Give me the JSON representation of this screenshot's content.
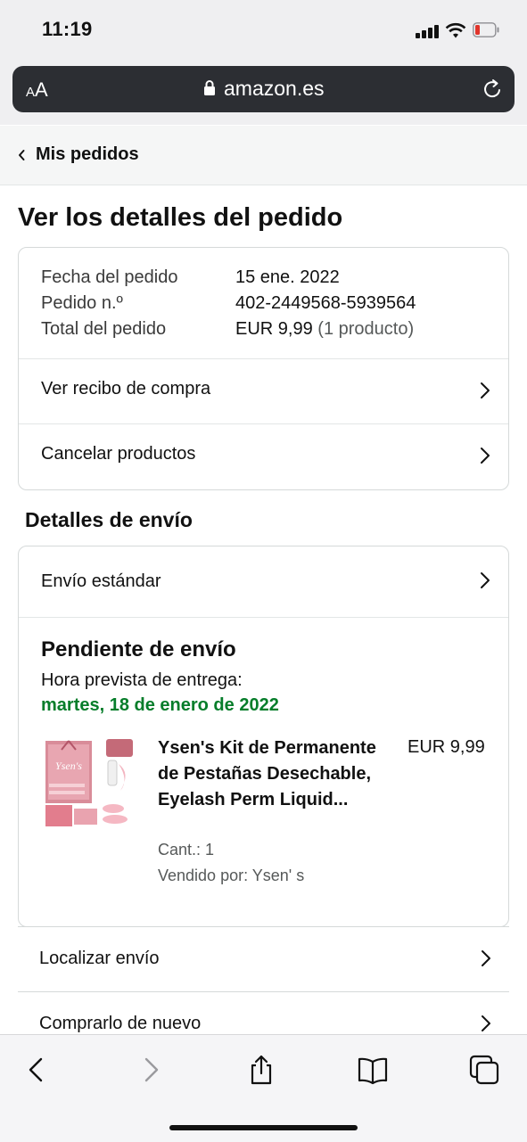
{
  "status_bar": {
    "time": "11:19"
  },
  "browser": {
    "text_size_label_small": "A",
    "text_size_label_large": "A",
    "domain": "amazon.es"
  },
  "nav": {
    "back_label": "Mis pedidos"
  },
  "page": {
    "title": "Ver los detalles del pedido"
  },
  "order_summary": {
    "rows": [
      {
        "label": "Fecha del pedido",
        "value": "15 ene. 2022"
      },
      {
        "label": "Pedido n.º",
        "value": "402-2449568-5939564"
      },
      {
        "label": "Total del pedido",
        "value": "EUR 9,99",
        "value_note": "(1 producto)"
      }
    ],
    "actions": [
      "Ver recibo de compra",
      "Cancelar productos"
    ]
  },
  "shipping": {
    "heading": "Detalles de envío",
    "method": "Envío estándar",
    "status": "Pendiente de envío",
    "eta_label": "Hora prevista de entrega:",
    "eta_date": "martes, 18 de enero de 2022",
    "eta_color": "#067d2a",
    "product": {
      "title": "Ysen's Kit de Permanente de Pestañas Desechable, Eyelash Perm Liquid...",
      "price": "EUR 9,99",
      "quantity": "Cant.: 1",
      "seller": "Vendido por: Ysen' s",
      "thumbnail_brand": "Ysen's"
    }
  },
  "more_actions": [
    "Localizar envío",
    "Comprarlo de nuevo"
  ],
  "toolbar_icons": [
    "back-icon",
    "forward-icon",
    "share-icon",
    "bookmarks-icon",
    "tabs-icon"
  ]
}
